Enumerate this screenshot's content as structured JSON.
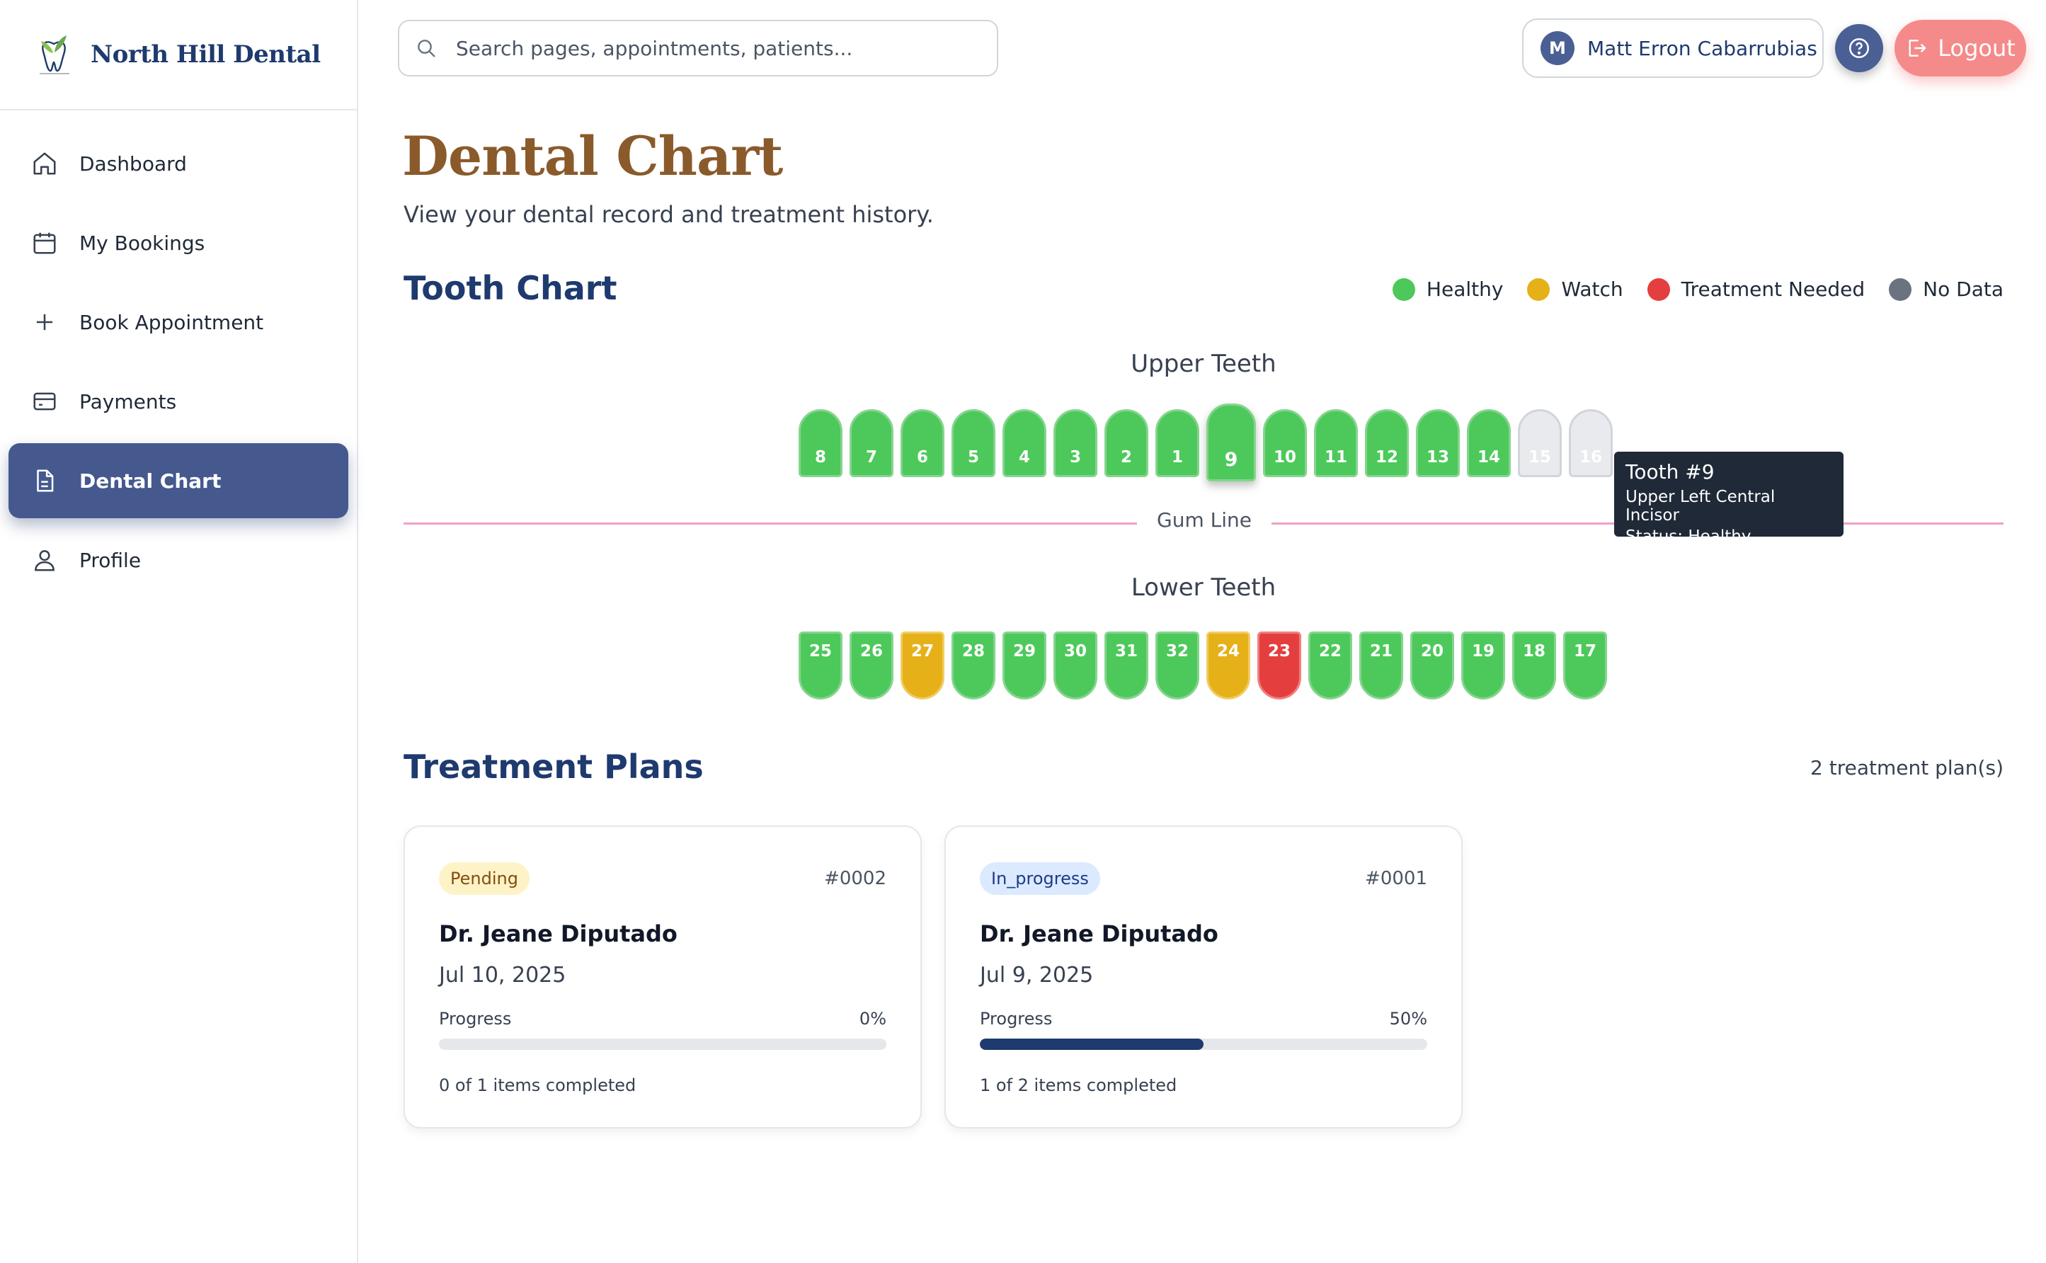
{
  "brand": {
    "name": "North Hill Dental"
  },
  "sidebar": {
    "items": [
      {
        "label": "Dashboard",
        "icon": "home-icon",
        "active": false
      },
      {
        "label": "My Bookings",
        "icon": "calendar-icon",
        "active": false
      },
      {
        "label": "Book Appointment",
        "icon": "plus-icon",
        "active": false
      },
      {
        "label": "Payments",
        "icon": "card-icon",
        "active": false
      },
      {
        "label": "Dental Chart",
        "icon": "document-icon",
        "active": true
      },
      {
        "label": "Profile",
        "icon": "user-icon",
        "active": false
      }
    ]
  },
  "search": {
    "placeholder": "Search pages, appointments, patients..."
  },
  "user": {
    "initial": "M",
    "name": "Matt Erron Cabarrubias"
  },
  "header": {
    "logout_label": "Logout"
  },
  "page": {
    "title": "Dental Chart",
    "subtitle": "View your dental record and treatment history."
  },
  "tooth_chart": {
    "title": "Tooth Chart",
    "legend": [
      {
        "label": "Healthy",
        "color": "#4cc95a"
      },
      {
        "label": "Watch",
        "color": "#e6b019"
      },
      {
        "label": "Treatment Needed",
        "color": "#e53e3e"
      },
      {
        "label": "No Data",
        "color": "#6b7280"
      }
    ],
    "upper_label": "Upper Teeth",
    "lower_label": "Lower Teeth",
    "gum_label": "Gum Line",
    "upper": [
      {
        "n": "8",
        "status": "healthy"
      },
      {
        "n": "7",
        "status": "healthy"
      },
      {
        "n": "6",
        "status": "healthy"
      },
      {
        "n": "5",
        "status": "healthy"
      },
      {
        "n": "4",
        "status": "healthy"
      },
      {
        "n": "3",
        "status": "healthy"
      },
      {
        "n": "2",
        "status": "healthy"
      },
      {
        "n": "1",
        "status": "healthy"
      },
      {
        "n": "9",
        "status": "healthy",
        "selected": true
      },
      {
        "n": "10",
        "status": "healthy"
      },
      {
        "n": "11",
        "status": "healthy"
      },
      {
        "n": "12",
        "status": "healthy"
      },
      {
        "n": "13",
        "status": "healthy"
      },
      {
        "n": "14",
        "status": "healthy"
      },
      {
        "n": "15",
        "status": "nodata"
      },
      {
        "n": "16",
        "status": "nodata"
      }
    ],
    "lower": [
      {
        "n": "25",
        "status": "healthy"
      },
      {
        "n": "26",
        "status": "healthy"
      },
      {
        "n": "27",
        "status": "watch"
      },
      {
        "n": "28",
        "status": "healthy"
      },
      {
        "n": "29",
        "status": "healthy"
      },
      {
        "n": "30",
        "status": "healthy"
      },
      {
        "n": "31",
        "status": "healthy"
      },
      {
        "n": "32",
        "status": "healthy"
      },
      {
        "n": "24",
        "status": "watch"
      },
      {
        "n": "23",
        "status": "needed"
      },
      {
        "n": "22",
        "status": "healthy"
      },
      {
        "n": "21",
        "status": "healthy"
      },
      {
        "n": "20",
        "status": "healthy"
      },
      {
        "n": "19",
        "status": "healthy"
      },
      {
        "n": "18",
        "status": "healthy"
      },
      {
        "n": "17",
        "status": "healthy"
      }
    ],
    "tooltip": {
      "title": "Tooth #9",
      "name": "Upper Left Central Incisor",
      "status": "Status: Healthy"
    }
  },
  "treatment_plans": {
    "title": "Treatment Plans",
    "count_label": "2 treatment plan(s)",
    "plans": [
      {
        "status": "Pending",
        "status_kind": "pending",
        "id": "#0002",
        "doctor": "Dr. Jeane Diputado",
        "date": "Jul 10, 2025",
        "progress_label": "Progress",
        "progress_pct": "0%",
        "progress_value": 0,
        "items": "0 of 1 items completed"
      },
      {
        "status": "In_progress",
        "status_kind": "progress",
        "id": "#0001",
        "doctor": "Dr. Jeane Diputado",
        "date": "Jul 9, 2025",
        "progress_label": "Progress",
        "progress_pct": "50%",
        "progress_value": 50,
        "items": "1 of 2 items completed"
      }
    ]
  }
}
